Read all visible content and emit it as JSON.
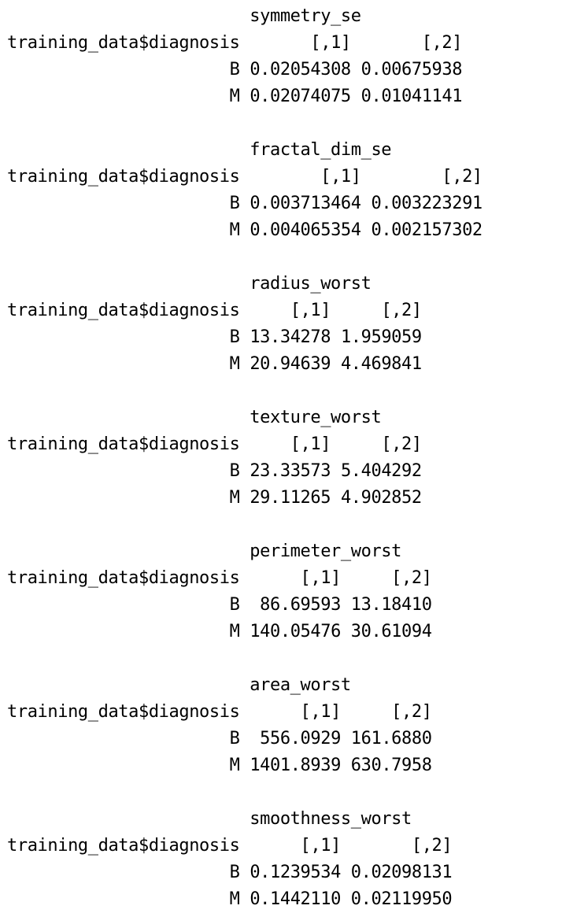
{
  "row_label_header": "training_data$diagnosis",
  "blocks": [
    {
      "name": "symmetry_se",
      "col1": "[,1]",
      "col2": "[,2]",
      "rows": [
        {
          "label": "B",
          "v1": "0.02054308",
          "v2": "0.00675938"
        },
        {
          "label": "M",
          "v1": "0.02074075",
          "v2": "0.01041141"
        }
      ]
    },
    {
      "name": "fractal_dim_se",
      "col1": "[,1]",
      "col2": "[,2]",
      "rows": [
        {
          "label": "B",
          "v1": "0.003713464",
          "v2": "0.003223291"
        },
        {
          "label": "M",
          "v1": "0.004065354",
          "v2": "0.002157302"
        }
      ]
    },
    {
      "name": "radius_worst",
      "col1": "[,1]",
      "col2": "[,2]",
      "rows": [
        {
          "label": "B",
          "v1": "13.34278",
          "v2": "1.959059"
        },
        {
          "label": "M",
          "v1": "20.94639",
          "v2": "4.469841"
        }
      ]
    },
    {
      "name": "texture_worst",
      "col1": "[,1]",
      "col2": "[,2]",
      "rows": [
        {
          "label": "B",
          "v1": "23.33573",
          "v2": "5.404292"
        },
        {
          "label": "M",
          "v1": "29.11265",
          "v2": "4.902852"
        }
      ]
    },
    {
      "name": "perimeter_worst",
      "col1": "[,1]",
      "col2": "[,2]",
      "rows": [
        {
          "label": "B",
          "v1": "86.69593",
          "v2": "13.18410"
        },
        {
          "label": "M",
          "v1": "140.05476",
          "v2": "30.61094"
        }
      ]
    },
    {
      "name": "area_worst",
      "col1": "[,1]",
      "col2": "[,2]",
      "rows": [
        {
          "label": "B",
          "v1": "556.0929",
          "v2": "161.6880"
        },
        {
          "label": "M",
          "v1": "1401.8939",
          "v2": "630.7958"
        }
      ]
    },
    {
      "name": "smoothness_worst",
      "col1": "[,1]",
      "col2": "[,2]",
      "rows": [
        {
          "label": "B",
          "v1": "0.1239534",
          "v2": "0.02098131"
        },
        {
          "label": "M",
          "v1": "0.1442110",
          "v2": "0.02119950"
        }
      ]
    }
  ]
}
